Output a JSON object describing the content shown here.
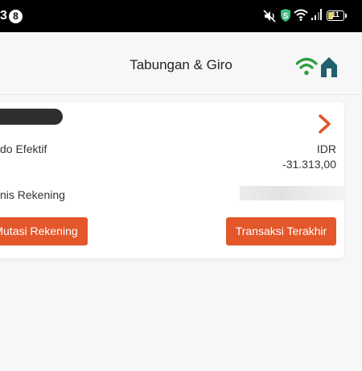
{
  "status_bar": {
    "clock_fragment": "3",
    "notification_count": "8",
    "battery_label": "11",
    "battery_level_percent": 11,
    "icons": [
      "mute-icon",
      "shield-app-icon",
      "wifi-icon",
      "signal-icon",
      "battery-icon"
    ]
  },
  "header": {
    "title": "Tabungan & Giro",
    "home_icon": "wifi-home-icon"
  },
  "account_card": {
    "balance_label": "do Efektif",
    "currency": "IDR",
    "amount": "-31.313,00",
    "account_type_label": "nis Rekening",
    "mutasi_button": "Mutasi Rekening",
    "transaksi_button": "Transaksi Terakhir",
    "chevron_icon": "chevron-right-icon"
  },
  "colors": {
    "accent": "#e4572a",
    "home_wifi": "#2e9e3e",
    "home_house": "#1f5f6e",
    "status_shield": "#3fbf7f",
    "background": "#f7f7f7",
    "card": "#ffffff"
  }
}
